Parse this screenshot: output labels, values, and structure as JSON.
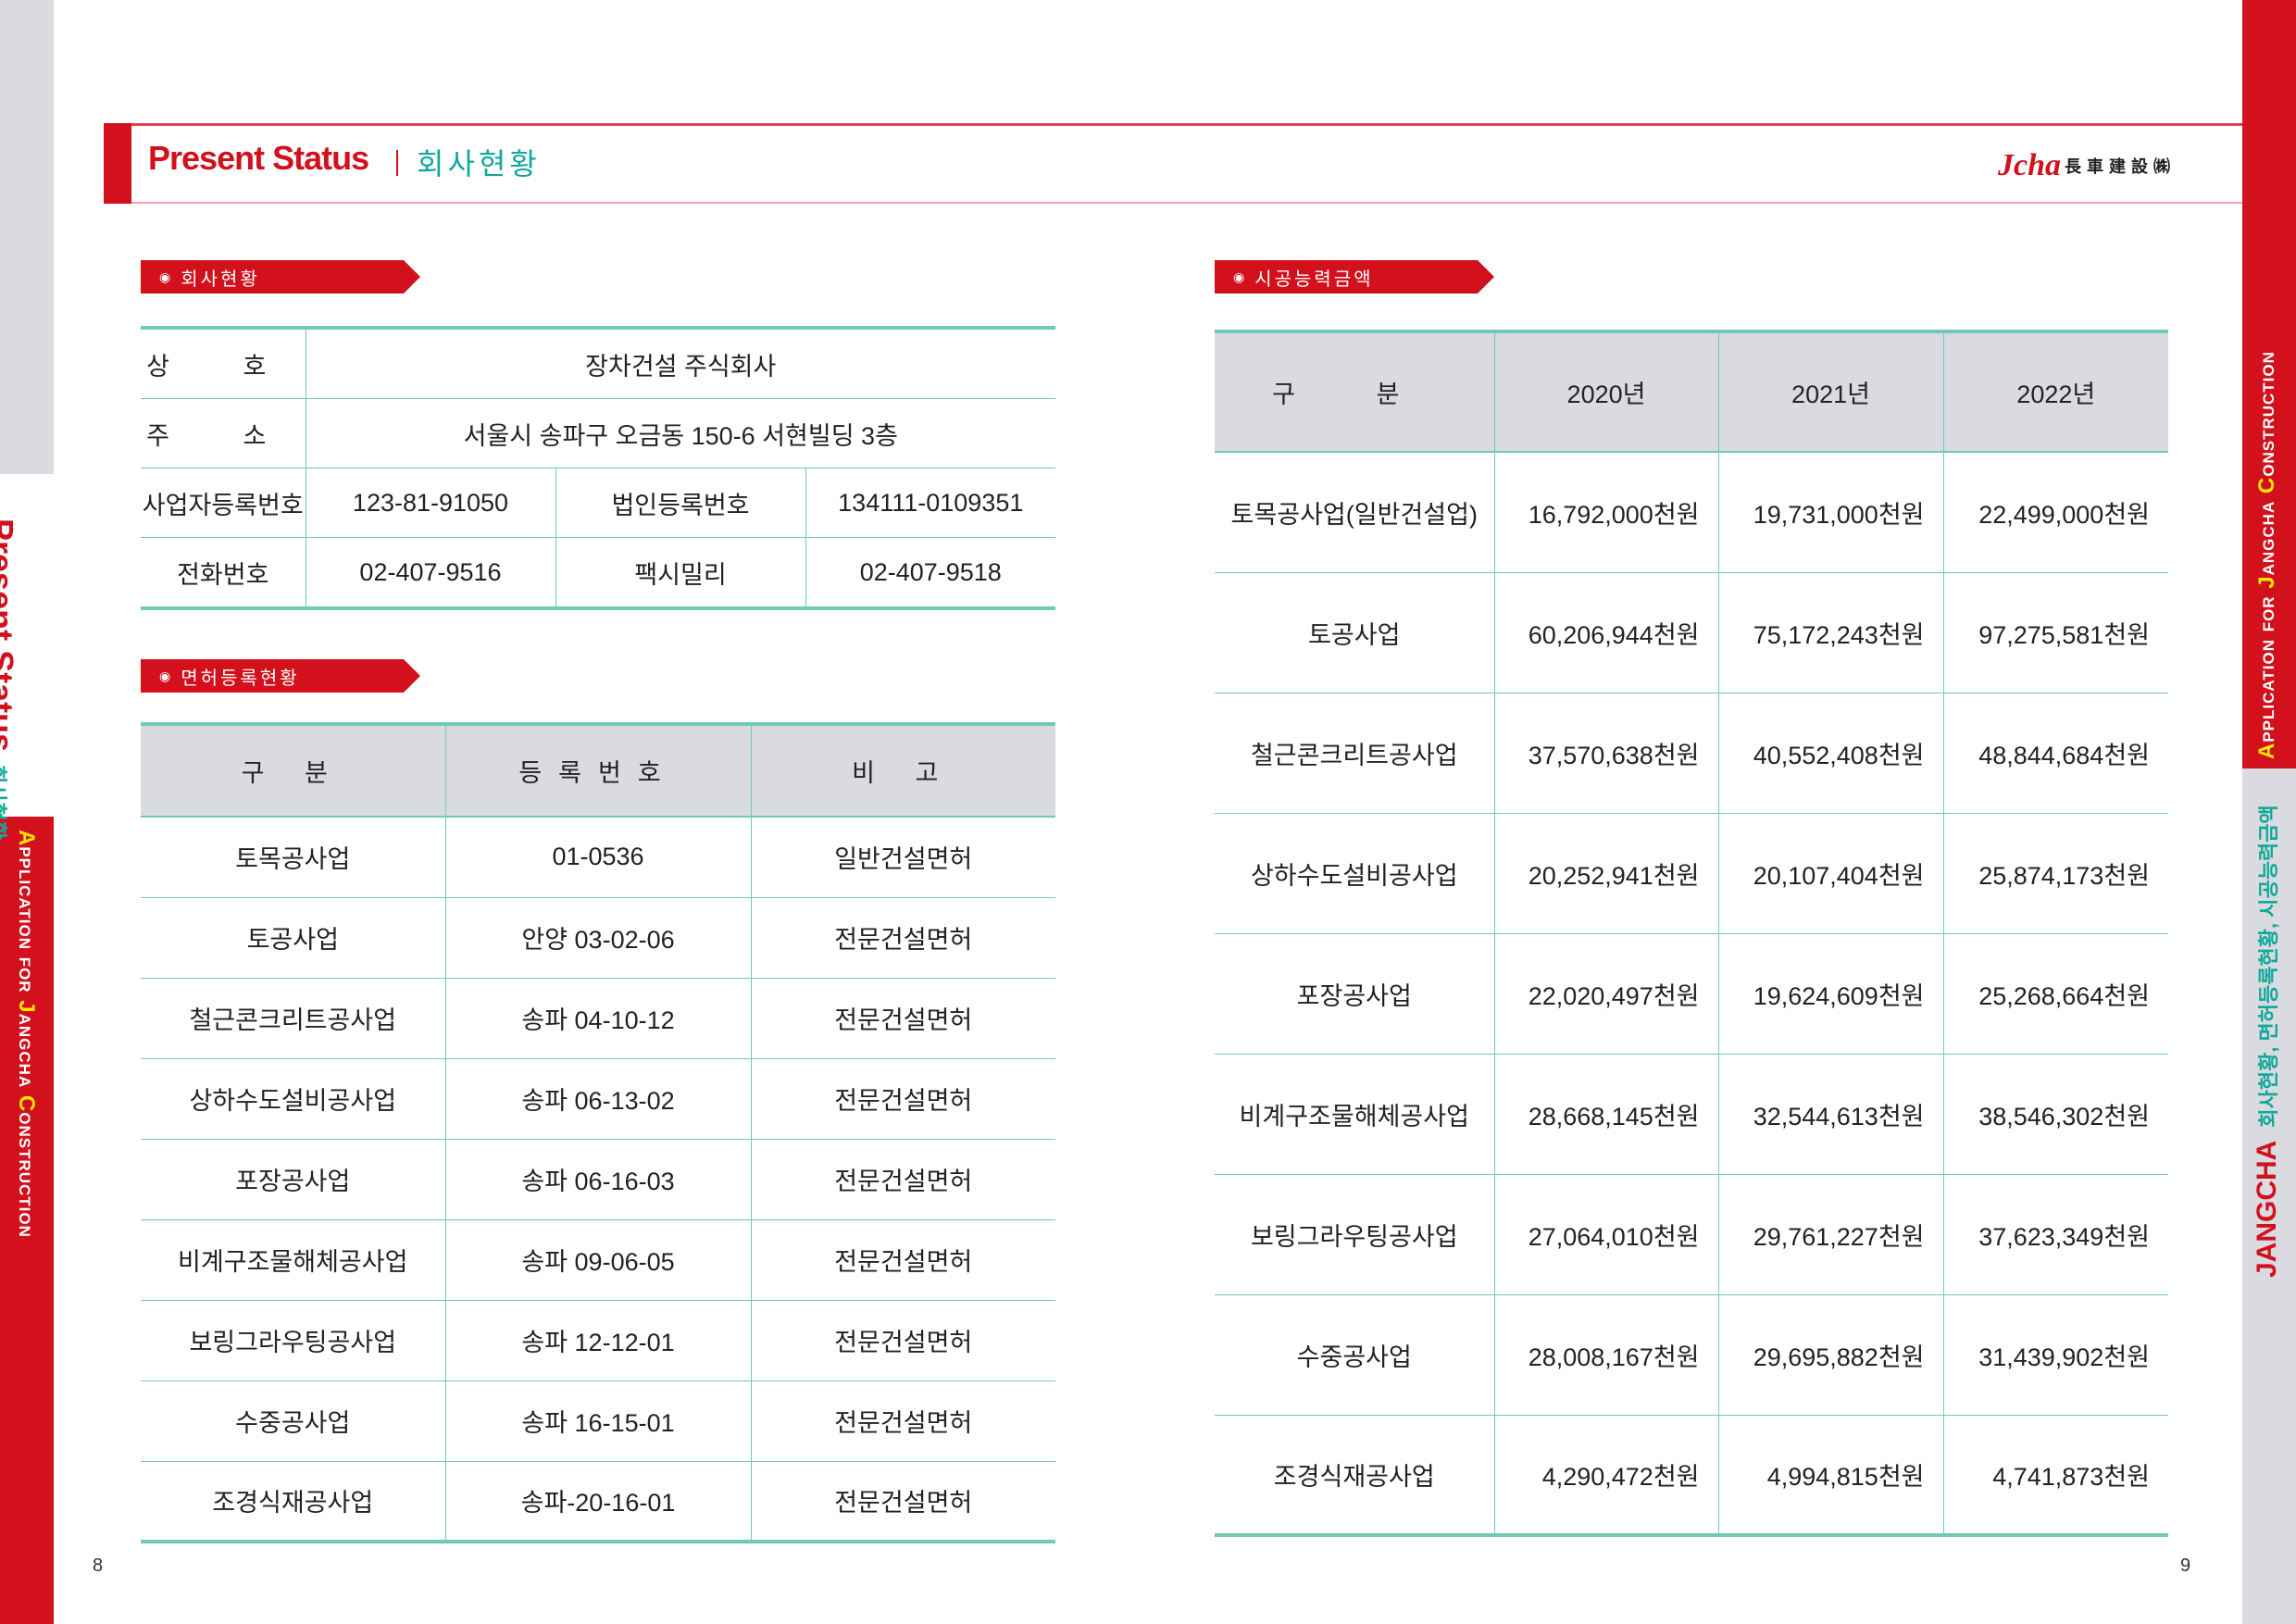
{
  "header": {
    "title": "Present Status",
    "subtitle": "회사현황",
    "logo_mark": "Jcha",
    "logo_text": "長車建設㈱"
  },
  "side": {
    "left_title": "Present Status",
    "left_sub": "회사현황",
    "app_a": "A",
    "app_1": "pplication for ",
    "app_j": "J",
    "app_2": "angcha ",
    "app_c": "C",
    "app_3": "onstruction",
    "right_title": "JANGCHA",
    "right_sub": "회사현황, 면허등록현황, 시공능력금액"
  },
  "company": {
    "label": "회사현황",
    "name_label": "상 호",
    "name_value": "장차건설 주식회사",
    "addr_label": "주 소",
    "addr_value": "서울시 송파구 오금동 150-6 서현빌딩 3층",
    "bizno_label": "사업자등록번호",
    "bizno_value": "123-81-91050",
    "corpno_label": "법인등록번호",
    "corpno_value": "134111-0109351",
    "tel_label": "전화번호",
    "tel_value": "02-407-9516",
    "fax_label": "팩시밀리",
    "fax_value": "02-407-9518"
  },
  "license": {
    "label": "면허등록현황",
    "headers": [
      "구 분",
      "등록번호",
      "비 고"
    ],
    "rows": [
      [
        "토목공사업",
        "01-0536",
        "일반건설면허"
      ],
      [
        "토공사업",
        "안양 03-02-06",
        "전문건설면허"
      ],
      [
        "철근콘크리트공사업",
        "송파 04-10-12",
        "전문건설면허"
      ],
      [
        "상하수도설비공사업",
        "송파 06-13-02",
        "전문건설면허"
      ],
      [
        "포장공사업",
        "송파 06-16-03",
        "전문건설면허"
      ],
      [
        "비계구조물해체공사업",
        "송파 09-06-05",
        "전문건설면허"
      ],
      [
        "보링그라우팅공사업",
        "송파 12-12-01",
        "전문건설면허"
      ],
      [
        "수중공사업",
        "송파 16-15-01",
        "전문건설면허"
      ],
      [
        "조경식재공사업",
        "송파-20-16-01",
        "전문건설면허"
      ]
    ]
  },
  "capacity": {
    "label": "시공능력금액",
    "headers": [
      "구 분",
      "2020년",
      "2021년",
      "2022년"
    ],
    "rows": [
      [
        "토목공사업(일반건설업)",
        "16,792,000천원",
        "19,731,000천원",
        "22,499,000천원"
      ],
      [
        "토공사업",
        "60,206,944천원",
        "75,172,243천원",
        "97,275,581천원"
      ],
      [
        "철근콘크리트공사업",
        "37,570,638천원",
        "40,552,408천원",
        "48,844,684천원"
      ],
      [
        "상하수도설비공사업",
        "20,252,941천원",
        "20,107,404천원",
        "25,874,173천원"
      ],
      [
        "포장공사업",
        "22,020,497천원",
        "19,624,609천원",
        "25,268,664천원"
      ],
      [
        "비계구조물해체공사업",
        "28,668,145천원",
        "32,544,613천원",
        "38,546,302천원"
      ],
      [
        "보링그라우팅공사업",
        "27,064,010천원",
        "29,761,227천원",
        "37,623,349천원"
      ],
      [
        "수중공사업",
        "28,008,167천원",
        "29,695,882천원",
        "31,439,902천원"
      ],
      [
        "조경식재공사업",
        "4,290,472천원",
        "4,994,815천원",
        "4,741,873천원"
      ]
    ]
  },
  "pages": {
    "left": "8",
    "right": "9"
  }
}
